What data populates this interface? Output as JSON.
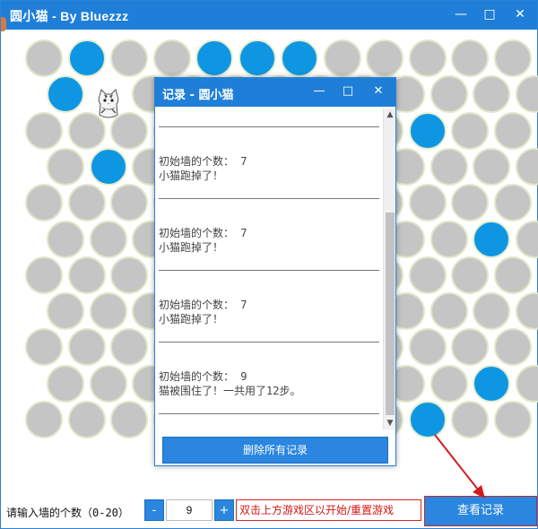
{
  "window": {
    "title": "圆小猫 - By Bluezzz",
    "minimize": "—",
    "maximize": "□",
    "close": "✕"
  },
  "board": {
    "rows": [
      [
        "empty",
        "wall",
        "empty",
        "empty",
        "wall",
        "wall",
        "wall",
        "empty",
        "empty",
        "empty",
        "empty",
        "empty"
      ],
      [
        "wall",
        "cat",
        "empty",
        "empty",
        "empty",
        "empty",
        "empty",
        "empty",
        "empty",
        "empty",
        "empty",
        "empty"
      ],
      [
        "empty",
        "empty",
        "empty",
        "empty",
        "empty",
        "empty",
        "empty",
        "empty",
        "empty",
        "wall",
        "empty",
        "empty"
      ],
      [
        "empty",
        "wall",
        "empty",
        "empty",
        "empty",
        "empty",
        "empty",
        "empty",
        "empty",
        "empty",
        "empty",
        "empty"
      ],
      [
        "empty",
        "empty",
        "empty",
        "empty",
        "empty",
        "empty",
        "empty",
        "empty",
        "empty",
        "empty",
        "empty",
        "empty"
      ],
      [
        "empty",
        "empty",
        "empty",
        "empty",
        "empty",
        "empty",
        "empty",
        "empty",
        "empty",
        "empty",
        "wall",
        "empty"
      ],
      [
        "empty",
        "empty",
        "empty",
        "empty",
        "empty",
        "empty",
        "empty",
        "empty",
        "empty",
        "empty",
        "empty",
        "empty"
      ],
      [
        "empty",
        "empty",
        "empty",
        "empty",
        "empty",
        "empty",
        "empty",
        "empty",
        "empty",
        "empty",
        "empty",
        "empty"
      ],
      [
        "empty",
        "empty",
        "empty",
        "empty",
        "empty",
        "empty",
        "empty",
        "empty",
        "empty",
        "empty",
        "empty",
        "empty"
      ],
      [
        "empty",
        "empty",
        "empty",
        "empty",
        "empty",
        "empty",
        "empty",
        "empty",
        "empty",
        "empty",
        "wall",
        "empty"
      ],
      [
        "empty",
        "empty",
        "empty",
        "empty",
        "empty",
        "empty",
        "empty",
        "wall",
        "empty",
        "wall",
        "empty",
        "empty"
      ]
    ]
  },
  "colors": {
    "wall": "#0f96e2",
    "empty": "#c5c5c5",
    "accent": "#2a86de",
    "hint_red": "#d41515"
  },
  "bottom": {
    "prompt": "请输入墙的个数（0-20）",
    "minus": "-",
    "count_value": "9",
    "plus": "+",
    "hint": "双击上方游戏区以开始/重置游戏",
    "view_records": "查看记录"
  },
  "dialog": {
    "title": "记录 - 圆小猫",
    "separator": "——————————————————————",
    "entries": [
      {
        "walls_text": "初始墙的个数： 7",
        "result": "小猫跑掉了！"
      },
      {
        "walls_text": "初始墙的个数： 7",
        "result": "小猫跑掉了！"
      },
      {
        "walls_text": "初始墙的个数： 7",
        "result": "小猫跑掉了！"
      },
      {
        "walls_text": "初始墙的个数： 9",
        "result": "猫被围住了！一共用了12步。"
      }
    ],
    "scroll_up": "▲",
    "scroll_down": "▼",
    "delete_all": "删除所有记录"
  }
}
